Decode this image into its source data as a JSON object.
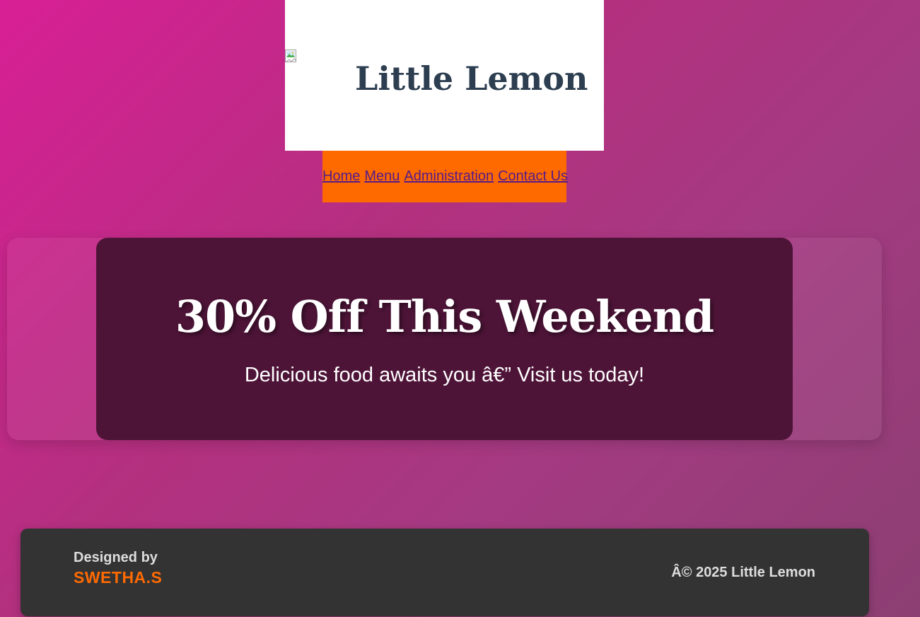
{
  "header": {
    "logo_icon": "broken-image-icon",
    "title": "Little Lemon"
  },
  "nav": {
    "items": [
      {
        "label": "Home"
      },
      {
        "label": "Menu"
      },
      {
        "label": "Administration"
      },
      {
        "label": "Contact Us"
      }
    ]
  },
  "promo": {
    "title": "30% Off This Weekend",
    "subtitle": "Delicious food awaits you â€” Visit us today!"
  },
  "footer": {
    "designed_label": "Designed by",
    "designer": "SWETHA.S",
    "copyright": "Â© 2025 Little Lemon"
  },
  "colors": {
    "nav_background": "#ff6a00",
    "promo_background": "#4e1438",
    "footer_background": "#333333",
    "accent": "#ff6a00",
    "title_text": "#2c3e50",
    "link": "#551a8b"
  }
}
